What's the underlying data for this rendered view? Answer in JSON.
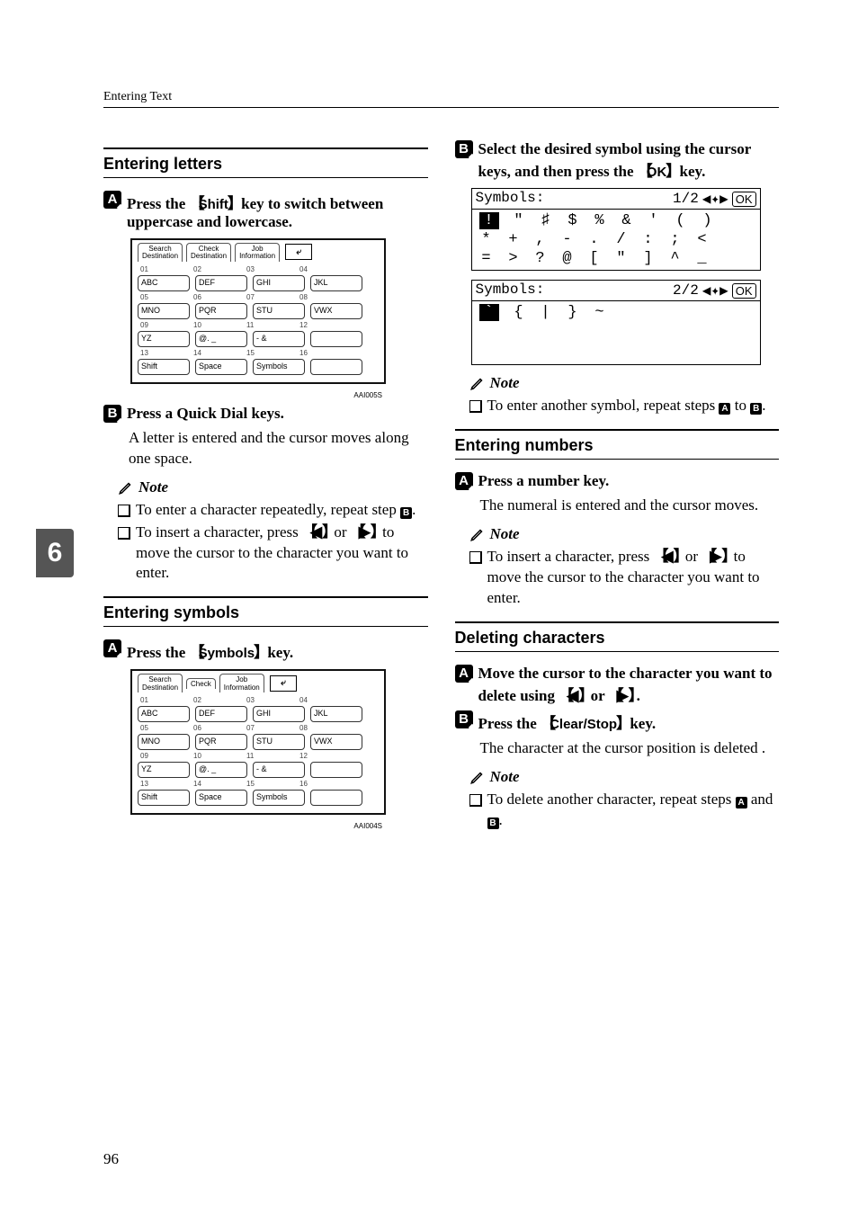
{
  "header": "Entering Text",
  "side_tab": "6",
  "page_number": "96",
  "left": {
    "section1_title": "Entering letters",
    "step1": "Press the ",
    "step1_key": "Shift",
    "step1_tail": " key to switch between uppercase and lowercase.",
    "diagram1": {
      "tabs": [
        {
          "l1": "Search",
          "l2": "Destination"
        },
        {
          "l1": "Check",
          "l2": "Destination"
        },
        {
          "l1": "Job",
          "l2": "Information"
        }
      ],
      "keys": [
        [
          "01",
          "02",
          "03",
          "04"
        ],
        [
          "ABC",
          "DEF",
          "GHI",
          "JKL"
        ],
        [
          "05",
          "06",
          "07",
          "08"
        ],
        [
          "MNO",
          "PQR",
          "STU",
          "VWX"
        ],
        [
          "09",
          "10",
          "11",
          "12"
        ],
        [
          "YZ",
          "@. _",
          "- &",
          ""
        ],
        [
          "13",
          "14",
          "15",
          "16"
        ],
        [
          "Shift",
          "Space",
          "Symbols",
          ""
        ]
      ],
      "caption": "AAI005S"
    },
    "step2": "Press a Quick Dial keys.",
    "step2_body": "A letter is entered and the cursor moves along one space.",
    "note1_heading": "Note",
    "note1_i1": "To enter a character repeatedly, repeat step ",
    "note1_i1_step": "B",
    "note1_i2a": "To insert a character, press ",
    "note1_i2b": " or ",
    "note1_i2c": " to move the cursor to the character you want to enter.",
    "section2_title": "Entering symbols",
    "step3": "Press the ",
    "step3_key": "Symbols",
    "step3_tail": " key.",
    "diagram2_caption": "AAI004S"
  },
  "right": {
    "step1": "Select the desired symbol using the cursor keys, and then press the ",
    "step1_key": "OK",
    "step1_tail": " key.",
    "sym1": {
      "title": "Symbols:",
      "page": "1/2",
      "rows": [
        [
          "!",
          "\"",
          "♯",
          "$",
          "%",
          "&",
          "'",
          "(",
          ")"
        ],
        [
          "*",
          "+",
          ",",
          "-",
          ".",
          "/",
          ":",
          ";",
          "<"
        ],
        [
          "=",
          ">",
          "?",
          "@",
          "[",
          "\"",
          "]",
          "^",
          "_"
        ]
      ]
    },
    "sym2": {
      "title": "Symbols:",
      "page": "2/2",
      "rows": [
        [
          "`",
          "{",
          "|",
          "}",
          "~",
          "",
          "",
          "",
          ""
        ]
      ]
    },
    "note1_heading": "Note",
    "note1": "To enter another symbol, repeat steps ",
    "note1_a": "A",
    "note1_b": " to ",
    "note1_c": "B",
    "section2_title": "Entering numbers",
    "step2": "Press a number key.",
    "step2_body": "The numeral is entered and the cursor moves.",
    "note2_heading": "Note",
    "note2a": "To insert a character, press ",
    "note2b": " or ",
    "note2c": " to move the cursor to the character you want to enter.",
    "section3_title": "Deleting characters",
    "step3": "Move the cursor to the character you want to delete using ",
    "step3b": " or ",
    "step4": "Press the ",
    "step4_key": "Clear/Stop",
    "step4_tail": " key.",
    "step4_body": "The character at the cursor position is deleted .",
    "note3_heading": "Note",
    "note3a": "To delete another character, repeat steps ",
    "note3b": " and ",
    "note3c": "."
  }
}
